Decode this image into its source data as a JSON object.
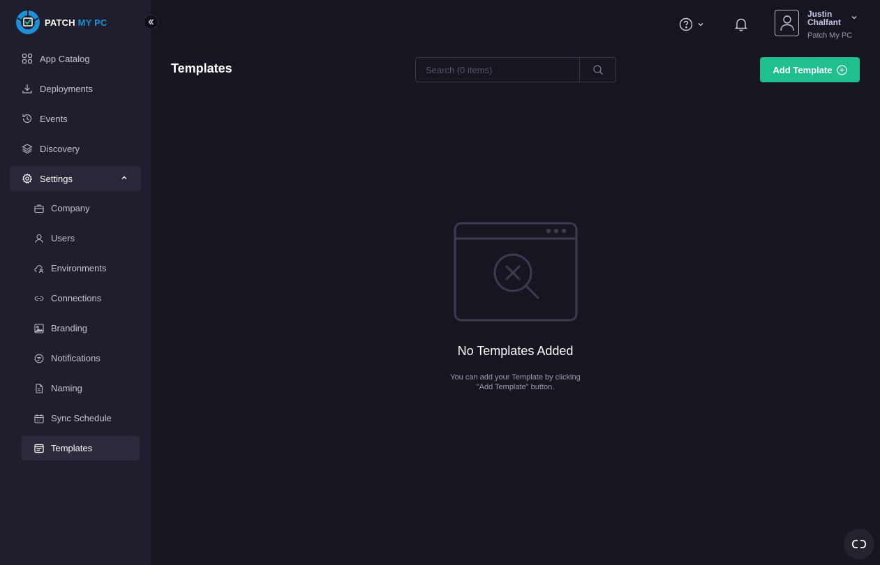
{
  "brand": {
    "logo_text_1": "PATCH",
    "logo_text_2": "MY PC",
    "accent_color": "#1fbf8f",
    "logo_blue": "#1f8fd6"
  },
  "sidebar": {
    "items": [
      {
        "label": "App Catalog",
        "icon": "grid-icon"
      },
      {
        "label": "Deployments",
        "icon": "download-icon"
      },
      {
        "label": "Events",
        "icon": "history-icon"
      },
      {
        "label": "Discovery",
        "icon": "layers-icon"
      }
    ],
    "settings": {
      "label": "Settings",
      "icon": "gear-icon",
      "expanded": true
    },
    "sub_items": [
      {
        "label": "Company",
        "icon": "briefcase-icon"
      },
      {
        "label": "Users",
        "icon": "user-icon"
      },
      {
        "label": "Environments",
        "icon": "cloud-user-icon"
      },
      {
        "label": "Connections",
        "icon": "link-icon"
      },
      {
        "label": "Branding",
        "icon": "image-icon"
      },
      {
        "label": "Notifications",
        "icon": "message-icon"
      },
      {
        "label": "Naming",
        "icon": "file-icon"
      },
      {
        "label": "Sync Schedule",
        "icon": "calendar-icon"
      },
      {
        "label": "Templates",
        "icon": "template-icon",
        "active": true
      }
    ]
  },
  "header": {
    "user_name": "Justin Chalfant",
    "user_org": "Patch My PC"
  },
  "main": {
    "title": "Templates",
    "search_placeholder": "Search (0 items)",
    "add_button_label": "Add Template",
    "empty_title": "No Templates Added",
    "empty_desc": "You can add your Template by clicking \"Add Template\" button."
  }
}
